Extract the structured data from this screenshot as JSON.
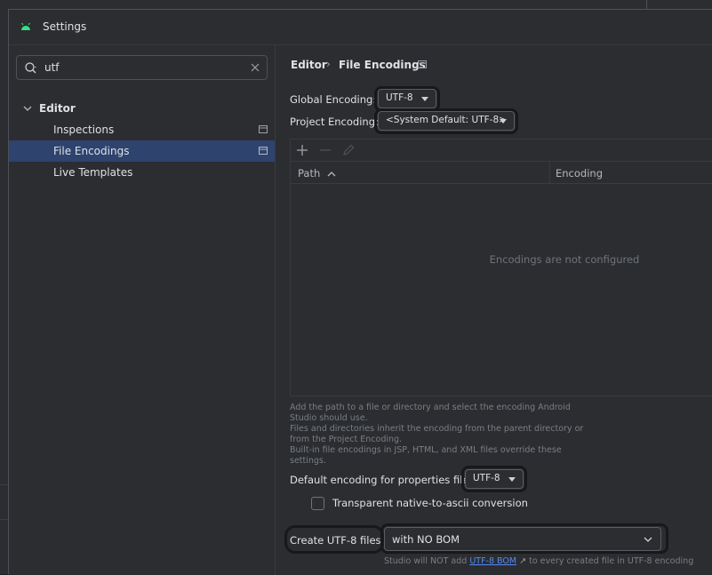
{
  "window": {
    "title": "Settings"
  },
  "search": {
    "value": "utf"
  },
  "tree": {
    "editor": "Editor",
    "items": [
      {
        "label": "Inspections"
      },
      {
        "label": "File Encodings"
      },
      {
        "label": "Live Templates"
      }
    ]
  },
  "breadcrumb": {
    "parent": "Editor",
    "separator": "›",
    "current": "File Encodings"
  },
  "encoding": {
    "global_label": "Global Encoding:",
    "global_value": "UTF-8",
    "project_label": "Project Encoding:",
    "project_value": "<System Default: UTF-8>"
  },
  "table": {
    "col_path": "Path",
    "sort_indicator": "^",
    "col_encoding": "Encoding",
    "empty_text": "Encodings are not configured"
  },
  "help": {
    "line1": "Add the path to a file or directory and select the encoding Android Studio should use.",
    "line2": "Files and directories inherit the encoding from the parent directory or from the Project Encoding.",
    "line3": "Built-in file encodings in JSP, HTML, and XML files override these settings."
  },
  "properties": {
    "label": "Default encoding for properties files:",
    "value": "UTF-8",
    "transparent_label": "Transparent native-to-ascii conversion",
    "transparent_checked": false
  },
  "utf8": {
    "label": "Create UTF-8 files:",
    "value": "with NO BOM",
    "note_prefix": "Studio will NOT add",
    "note_link": "UTF-8 BOM",
    "note_arrow": "↗",
    "note_suffix": "to every created file in UTF-8 encoding"
  },
  "colors": {
    "selection": "#2e436e",
    "accent": "#548af7",
    "android": "#3ddc84"
  }
}
